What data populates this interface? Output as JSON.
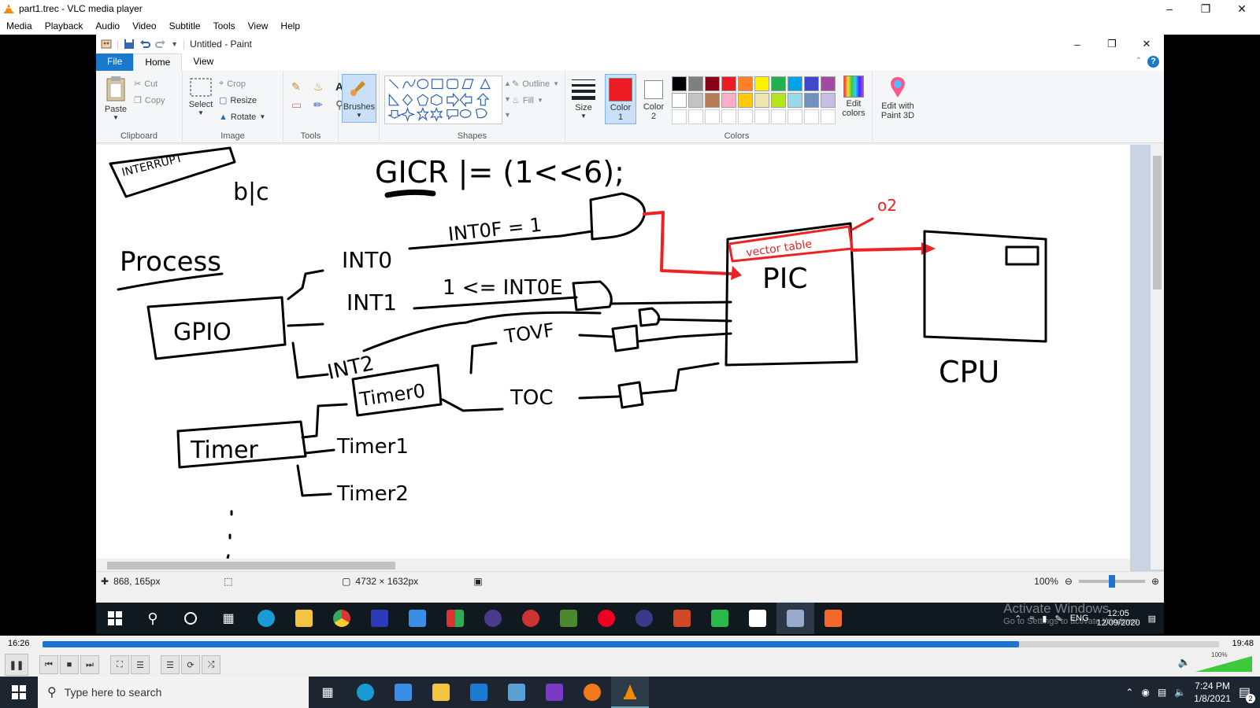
{
  "vlc": {
    "title": "part1.trec - VLC media player",
    "menu": [
      "Media",
      "Playback",
      "Audio",
      "Video",
      "Subtitle",
      "Tools",
      "View",
      "Help"
    ],
    "elapsed": "16:26",
    "total": "19:48",
    "progress": 0.83,
    "volume_label": "100%",
    "volume": 1.0
  },
  "paint": {
    "title": "Untitled - Paint",
    "tabs": {
      "file": "File",
      "home": "Home",
      "view": "View"
    },
    "clipboard": {
      "paste": "Paste",
      "cut": "Cut",
      "copy": "Copy",
      "label": "Clipboard"
    },
    "image": {
      "select": "Select",
      "crop": "Crop",
      "resize": "Resize",
      "rotate": "Rotate",
      "label": "Image"
    },
    "tools": {
      "label": "Tools"
    },
    "brushes": "Brushes",
    "shapes": {
      "outline": "Outline",
      "fill": "Fill",
      "label": "Shapes"
    },
    "size": "Size",
    "color1": "Color\n1",
    "color1_a": "Color",
    "color1_b": "1",
    "color2_a": "Color",
    "color2_b": "2",
    "colors_label": "Colors",
    "edit_colors_a": "Edit",
    "edit_colors_b": "colors",
    "edit3d_a": "Edit with",
    "edit3d_b": "Paint 3D",
    "palette_row1": [
      "#000000",
      "#7f7f7f",
      "#880015",
      "#ed1c24",
      "#ff7f27",
      "#fff200",
      "#22b14c",
      "#00a2e8",
      "#3f48cc",
      "#a349a4"
    ],
    "palette_row2": [
      "#ffffff",
      "#c3c3c3",
      "#b97a57",
      "#ffaec9",
      "#ffc90e",
      "#efe4b0",
      "#b5e61d",
      "#99d9ea",
      "#7092be",
      "#c8bfe7"
    ],
    "color1_value": "#ed1c24",
    "color2_value": "#ffffff",
    "status": {
      "cursor": "868, 165px",
      "canvas_size": "4732 × 1632px",
      "zoom": "100%"
    },
    "drawing": {
      "interrupt": "INTERRUPT",
      "reg": "GICR |= (1<<6);",
      "blc": "b|c",
      "process": "Process",
      "gpio": "GPIO",
      "int0": "INT0",
      "int1": "INT1",
      "int2": "INT2",
      "int0f": "INT0F = 1",
      "int0e": "1 <= INT0E",
      "tovf": "TOVF",
      "toc": "TOC",
      "timer0": "Timer0",
      "timer": "Timer",
      "timer1": "Timer1",
      "timer2": "Timer2",
      "pic": "PIC",
      "cpu": "CPU",
      "pic_box": "vector table",
      "o2": "o2"
    }
  },
  "rec_taskbar": {
    "lang": "ENG",
    "time": "12:05",
    "date": "12/09/2020",
    "watermark1": "Activate Windows",
    "watermark2": "Go to Settings to activate Windows."
  },
  "host_taskbar": {
    "search_placeholder": "Type here to search",
    "time": "7:24 PM",
    "date": "1/8/2021",
    "notif_count": "2"
  }
}
